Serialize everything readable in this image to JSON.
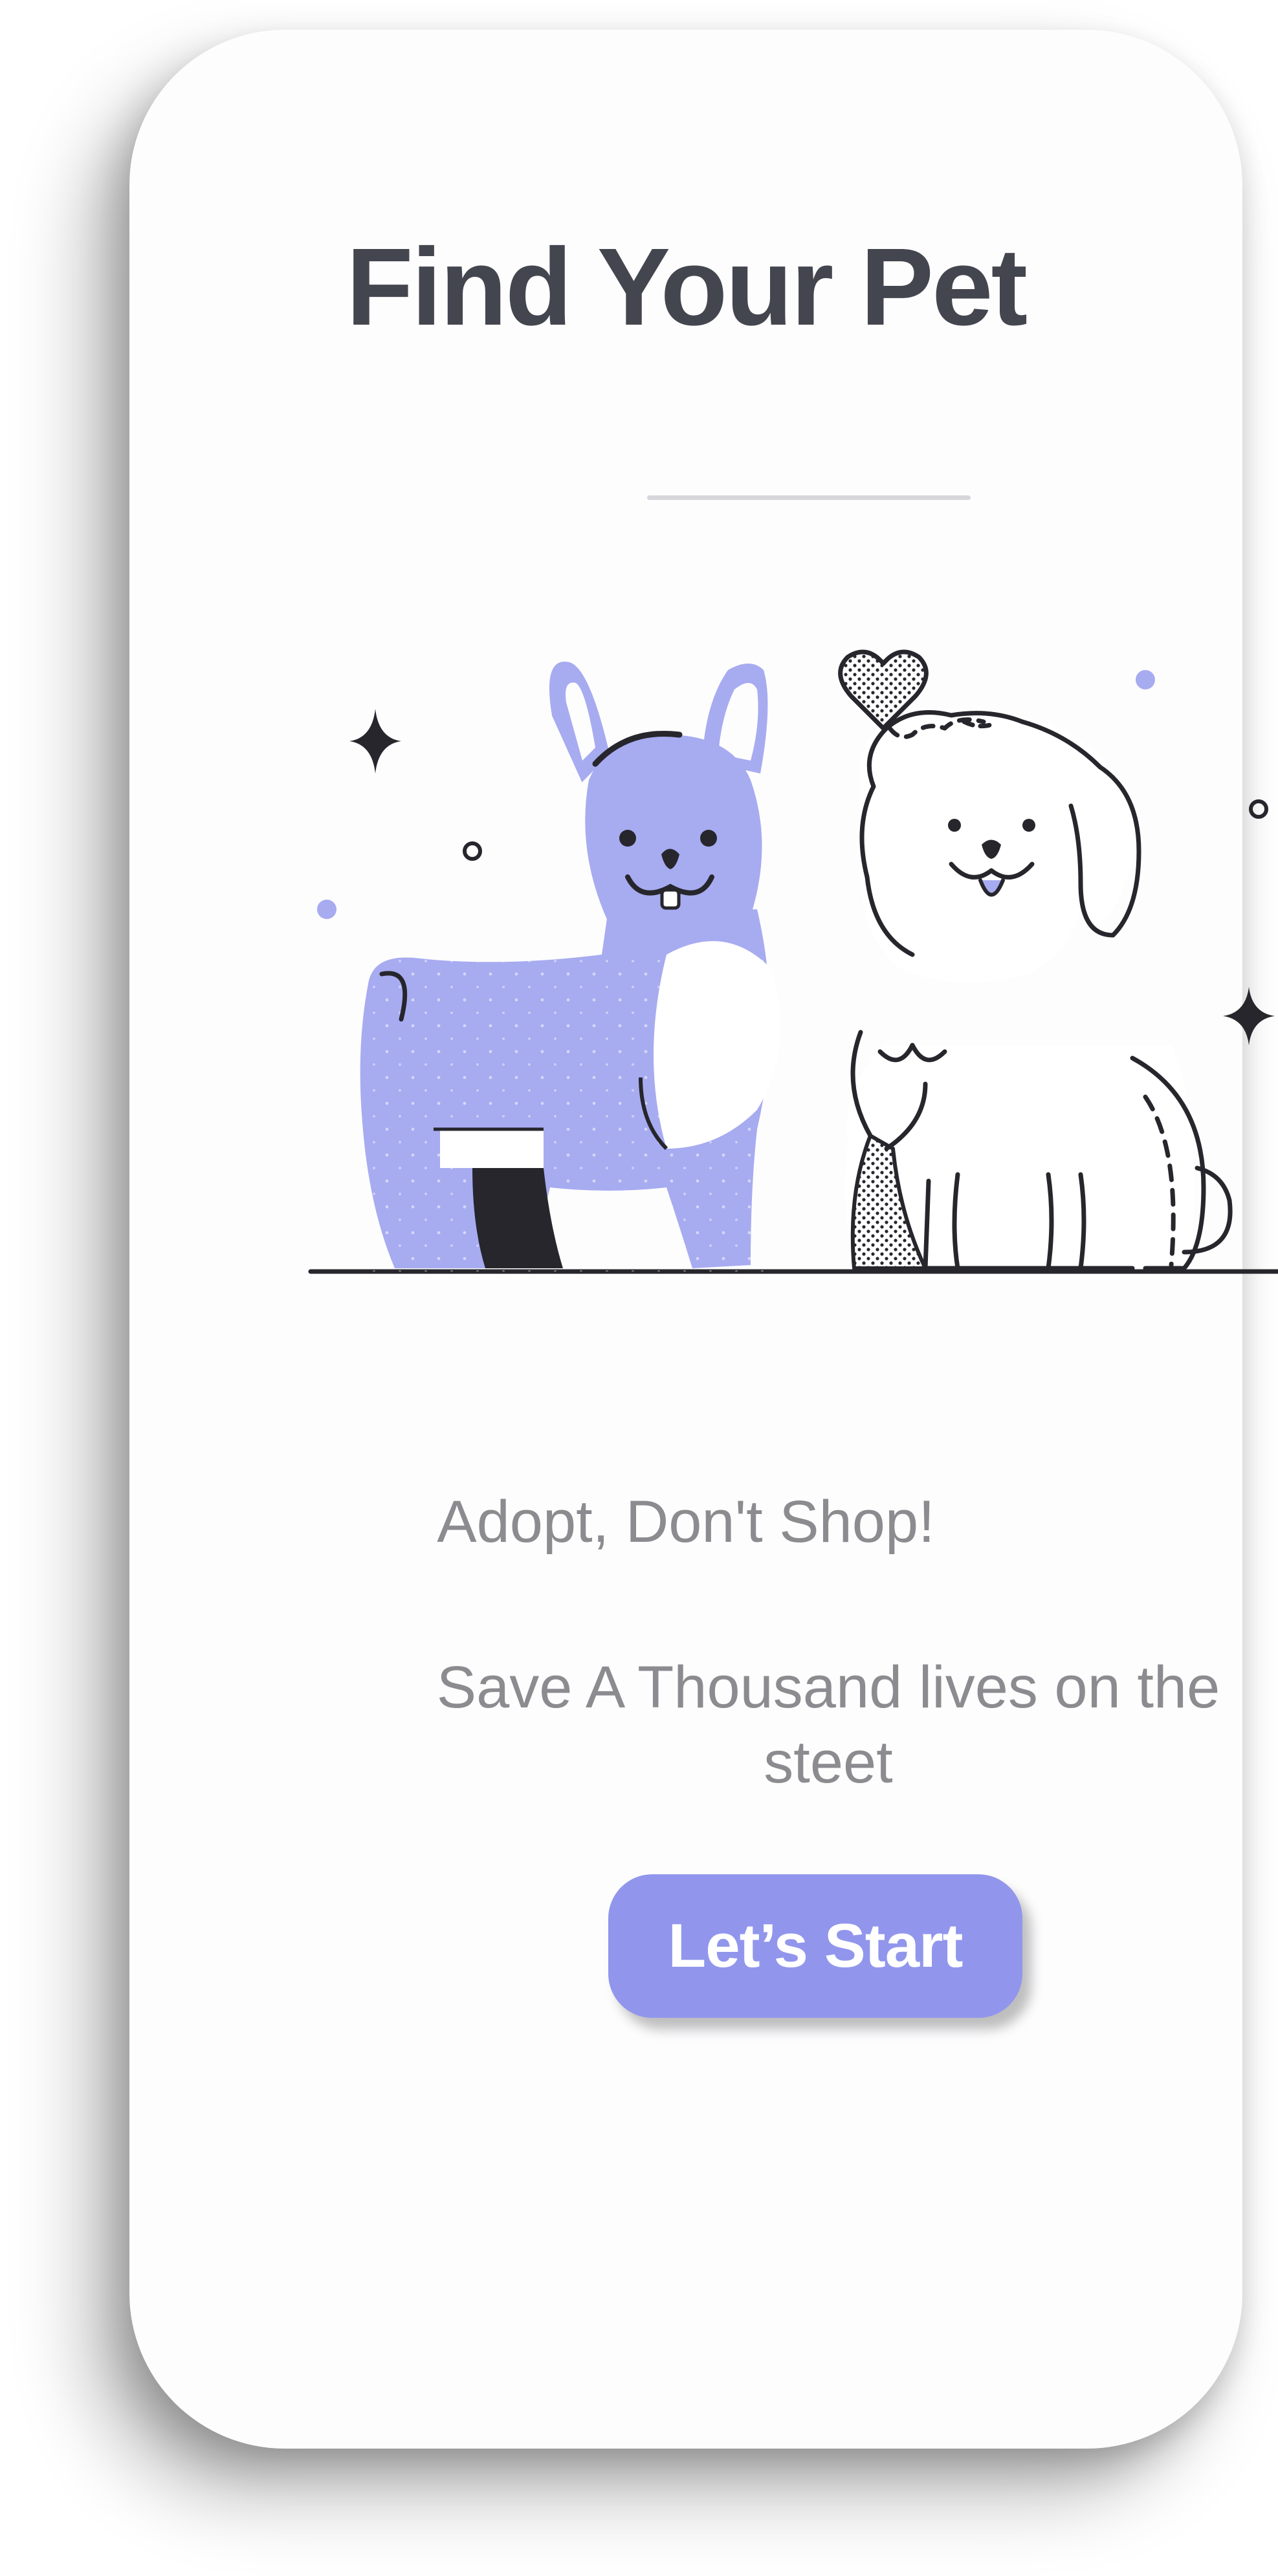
{
  "screen": {
    "title": "Find Your Pet",
    "tagline": "Adopt, Don't Shop!",
    "subtext": "Save A Thousand lives on the steet",
    "cta_label": "Let’s Start"
  },
  "theme": {
    "accent": "#9196ec",
    "title_color": "#44464f",
    "body_text_color": "#8c8c90",
    "illustration_lavender": "#a7abf0",
    "illustration_ink": "#26262c"
  },
  "illustration": {
    "icons": [
      "dog-left-icon",
      "puppy-right-icon",
      "heart-icon",
      "sparkle-icon",
      "circle-dot-icon"
    ]
  }
}
